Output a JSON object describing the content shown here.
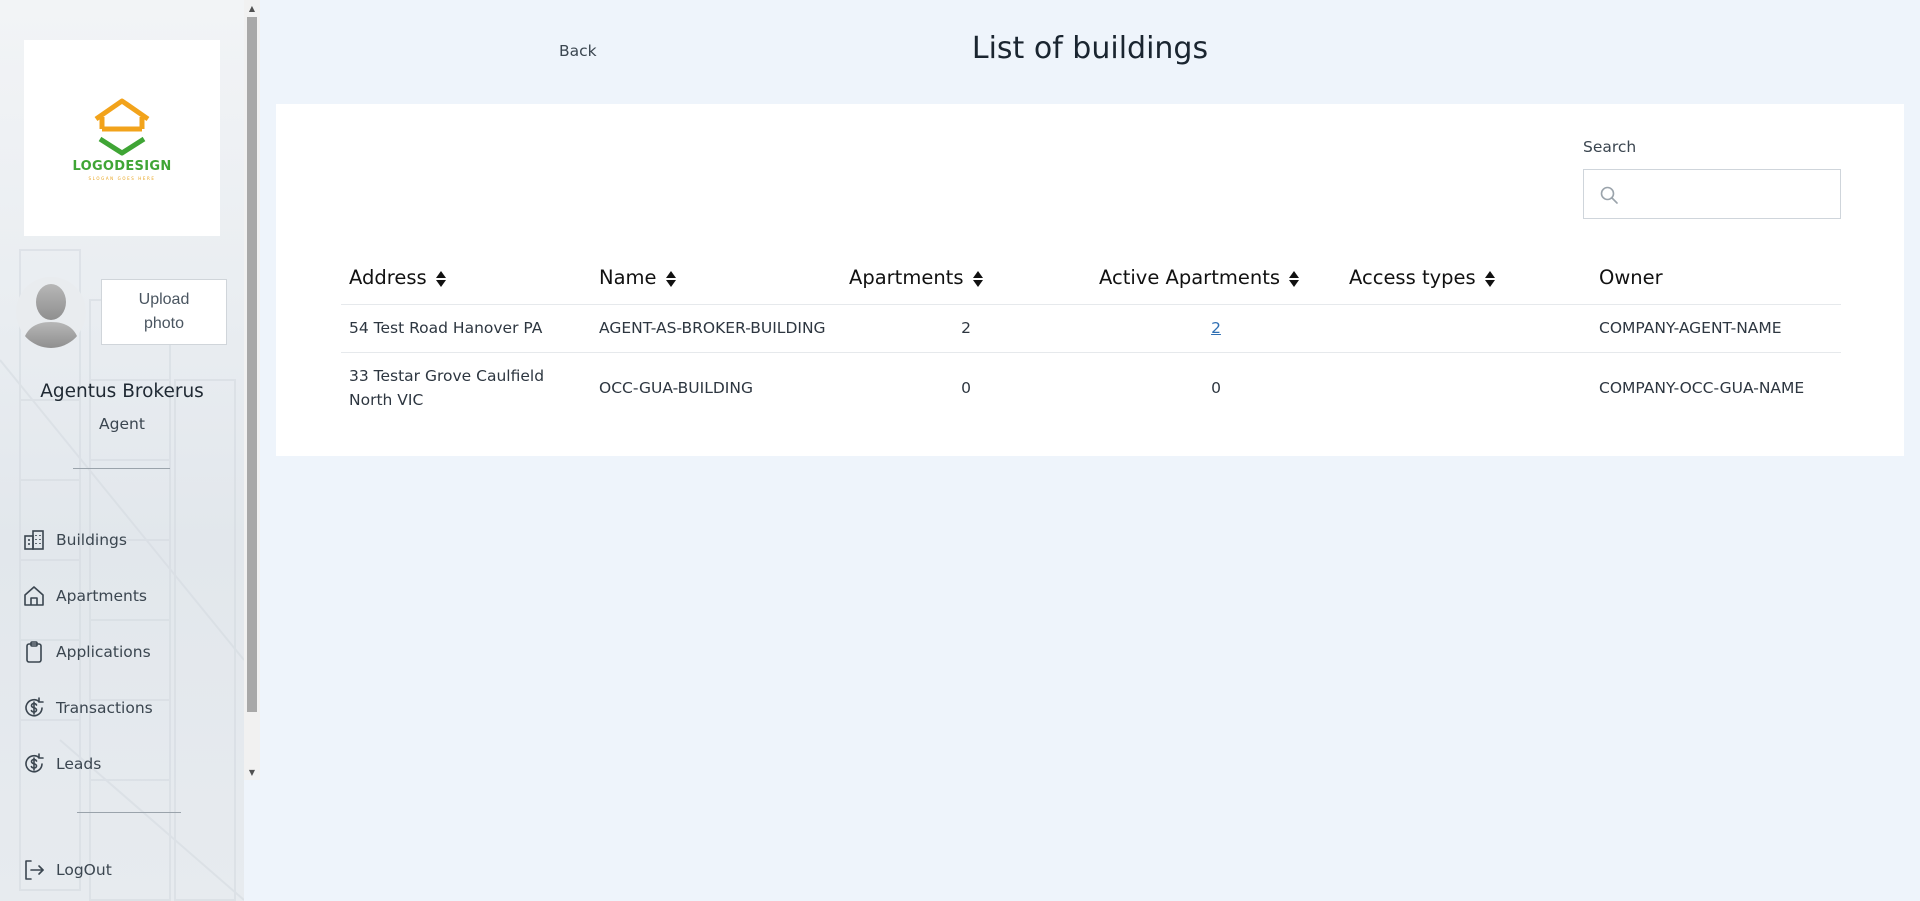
{
  "sidebar": {
    "logo": {
      "text": "LOGODESIGN",
      "slogan": "SLOGAN GOES HERE",
      "colors": {
        "house": "#f2a31b",
        "check": "#3fa535"
      }
    },
    "upload_photo": "Upload\nphoto",
    "user_name": "Agentus Brokerus",
    "user_role": "Agent",
    "nav": [
      {
        "label": "Buildings",
        "icon": "building-icon"
      },
      {
        "label": "Apartments",
        "icon": "home-icon"
      },
      {
        "label": "Applications",
        "icon": "clipboard-icon"
      },
      {
        "label": "Transactions",
        "icon": "dollar-cycle-icon"
      },
      {
        "label": "Leads",
        "icon": "dollar-cycle-icon"
      }
    ],
    "logout": "LogOut"
  },
  "header": {
    "back": "Back",
    "title": "List of buildings"
  },
  "search": {
    "label": "Search",
    "value": ""
  },
  "table": {
    "columns": [
      "Address",
      "Name",
      "Apartments",
      "Active Apartments",
      "Access types",
      "Owner"
    ],
    "rows": [
      {
        "address": "54 Test Road Hanover PA",
        "name": "AGENT-AS-BROKER-BUILDING",
        "apartments": "2",
        "active_apartments": "2",
        "access_types": "",
        "owner": "COMPANY-AGENT-NAME"
      },
      {
        "address": "33 Testar Grove Caulfield North VIC",
        "name": "OCC-GUA-BUILDING",
        "apartments": "0",
        "active_apartments": "0",
        "access_types": "",
        "owner": "COMPANY-OCC-GUA-NAME"
      }
    ]
  },
  "colors": {
    "page_bg": "#eef4fb",
    "link": "#2f6fb3"
  }
}
